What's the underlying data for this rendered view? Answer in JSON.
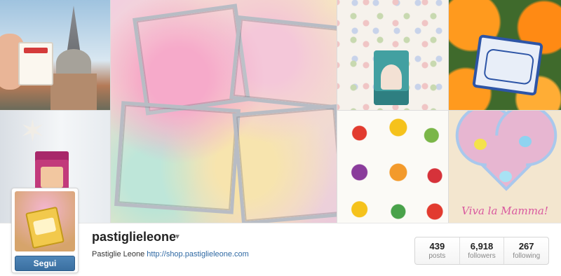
{
  "profile": {
    "username": "pastiglieleone",
    "full_name": "Pastiglie Leone",
    "website": "http://shop.pastiglieleone.com",
    "follow_label": "Segui"
  },
  "stats": [
    {
      "value": "439",
      "label": "posts"
    },
    {
      "value": "6,918",
      "label": "followers"
    },
    {
      "value": "267",
      "label": "following"
    }
  ],
  "mosaic": {
    "tile_7_caption": "Viva la Mamma!"
  },
  "icons": {
    "dropdown": "caret-down-icon"
  },
  "colors": {
    "follow_button": "#3a6fa0",
    "link": "#2f69a3"
  }
}
